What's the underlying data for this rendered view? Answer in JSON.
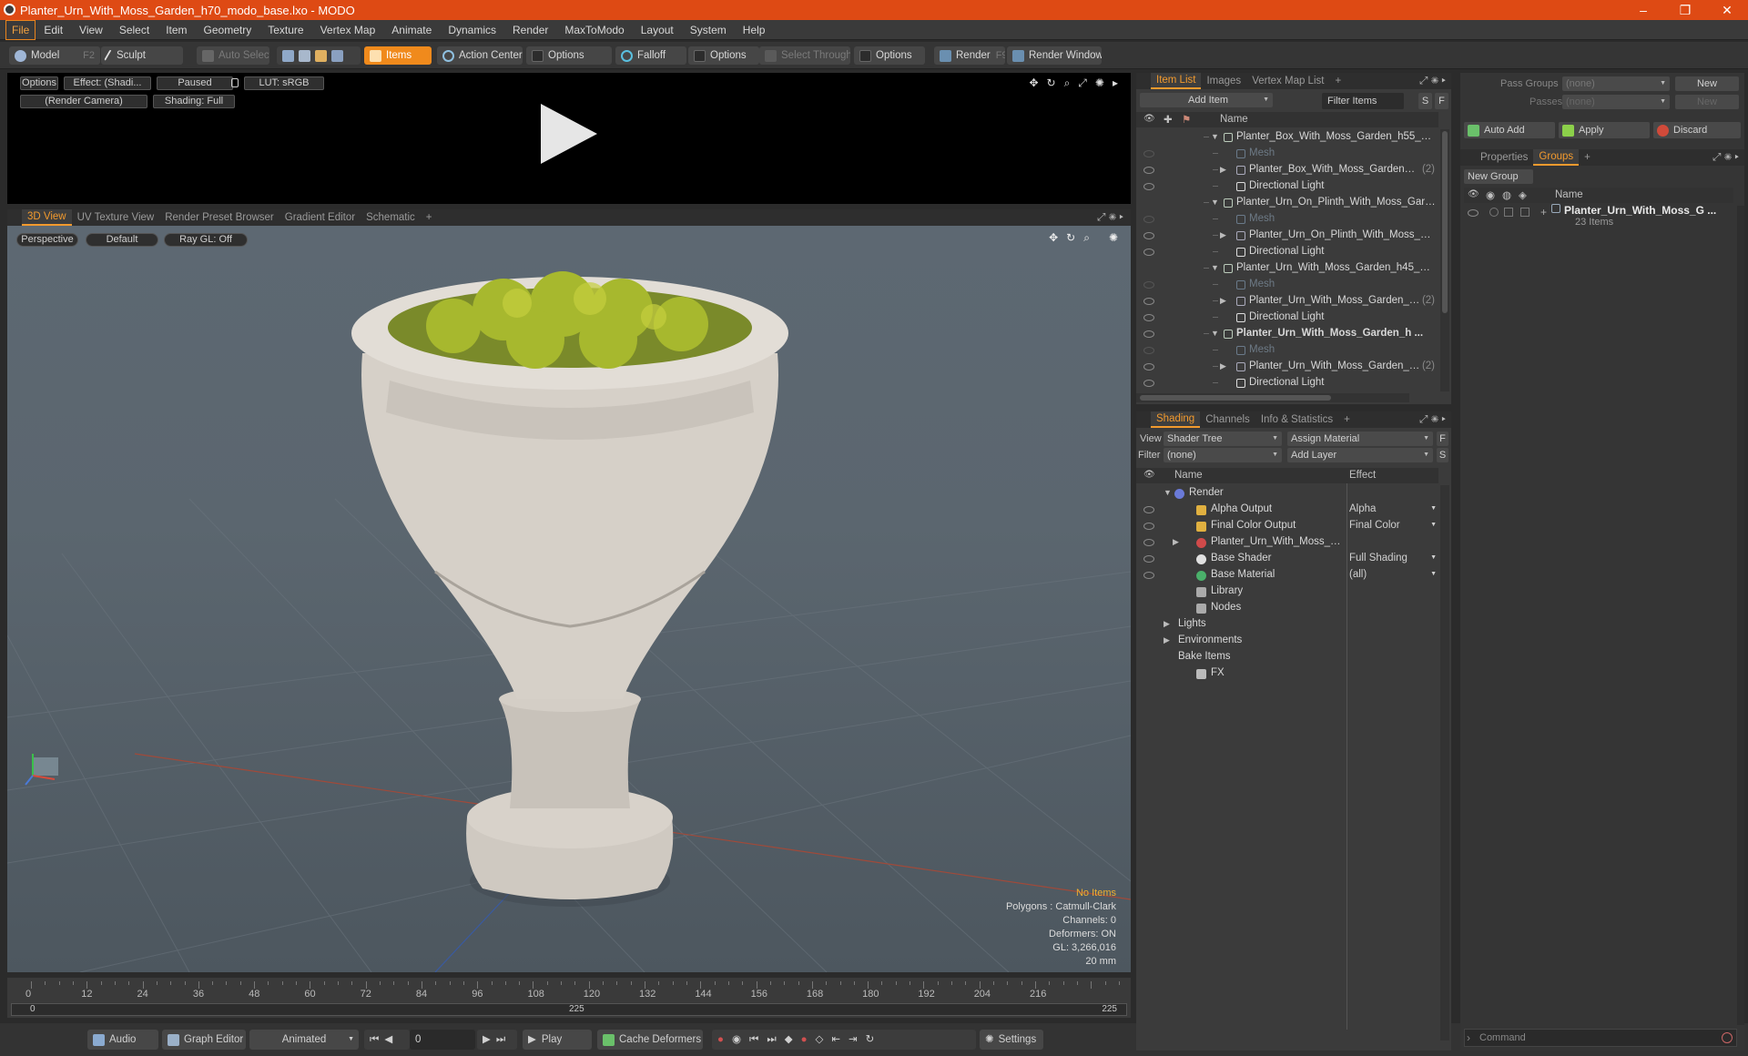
{
  "window": {
    "title": "Planter_Urn_With_Moss_Garden_h70_modo_base.lxo - MODO",
    "min": "–",
    "max": "❐",
    "close": "✕"
  },
  "menu": [
    "File",
    "Edit",
    "View",
    "Select",
    "Item",
    "Geometry",
    "Texture",
    "Vertex Map",
    "Animate",
    "Dynamics",
    "Render",
    "MaxToModo",
    "Layout",
    "System",
    "Help"
  ],
  "toolbar": {
    "model": "Model",
    "model_key": "F2",
    "sculpt": "Sculpt",
    "auto_select": "Auto Select",
    "items": "Items",
    "action_center": "Action Center",
    "options1": "Options",
    "falloff": "Falloff",
    "options2": "Options",
    "select_through": "Select Through",
    "options3": "Options",
    "render": "Render",
    "render_key": "F9",
    "render_window": "Render Window"
  },
  "render_preview": {
    "options": "Options",
    "effect": "Effect: (Shadi...",
    "paused": "Paused",
    "lut": "LUT: sRGB",
    "camera": "(Render Camera)",
    "shading": "Shading: Full"
  },
  "view_tabs": [
    "3D View",
    "UV Texture View",
    "Render Preset Browser",
    "Gradient Editor",
    "Schematic",
    "+"
  ],
  "viewport": {
    "perspective": "Perspective",
    "default": "Default",
    "raygl": "Ray GL: Off",
    "hud": {
      "no_items": "No Items",
      "polygons": "Polygons : Catmull-Clark",
      "channels": "Channels: 0",
      "deformers": "Deformers: ON",
      "gl": "GL: 3,266,016",
      "scale": "20 mm"
    }
  },
  "timeline": {
    "ticks": [
      "0",
      "12",
      "24",
      "36",
      "48",
      "60",
      "72",
      "84",
      "96",
      "108",
      "120",
      "132",
      "144",
      "156",
      "168",
      "180",
      "192",
      "204",
      "216"
    ],
    "range_start": "0",
    "range_mid": "225",
    "range_end": "225"
  },
  "bottom": {
    "audio": "Audio",
    "graph_editor": "Graph Editor",
    "animated": "Animated",
    "frame": "0",
    "play": "Play",
    "cache": "Cache Deformers",
    "settings": "Settings"
  },
  "item_list": {
    "tabs": [
      "Item List",
      "Images",
      "Vertex Map List",
      "+"
    ],
    "add_item": "Add Item",
    "filter": "Filter Items",
    "s": "S",
    "f": "F",
    "col_name": "Name",
    "rows": [
      {
        "indent": 1,
        "arrow": "▼",
        "label": "Planter_Box_With_Moss_Garden_h55_mo...",
        "eye": false,
        "kind": "scene",
        "bold": false
      },
      {
        "indent": 2,
        "arrow": "",
        "label": "Mesh",
        "eye": true,
        "kind": "mesh",
        "dim": true
      },
      {
        "indent": 2,
        "arrow": "▶",
        "label": "Planter_Box_With_Moss_Garden_h55",
        "count": "(2)",
        "eye": true,
        "kind": "item"
      },
      {
        "indent": 2,
        "arrow": "",
        "label": "Directional Light",
        "eye": true,
        "kind": "light"
      },
      {
        "indent": 1,
        "arrow": "▼",
        "label": "Planter_Urn_On_Plinth_With_Moss_Garde...",
        "eye": false,
        "kind": "scene"
      },
      {
        "indent": 2,
        "arrow": "",
        "label": "Mesh",
        "eye": true,
        "kind": "mesh",
        "dim": true
      },
      {
        "indent": 2,
        "arrow": "▶",
        "label": "Planter_Urn_On_Plinth_With_Moss_Gar...",
        "eye": true,
        "kind": "item"
      },
      {
        "indent": 2,
        "arrow": "",
        "label": "Directional Light",
        "eye": true,
        "kind": "light"
      },
      {
        "indent": 1,
        "arrow": "▼",
        "label": "Planter_Urn_With_Moss_Garden_h45_mo ...",
        "eye": false,
        "kind": "scene"
      },
      {
        "indent": 2,
        "arrow": "",
        "label": "Mesh",
        "eye": true,
        "kind": "mesh",
        "dim": true
      },
      {
        "indent": 2,
        "arrow": "▶",
        "label": "Planter_Urn_With_Moss_Garden_h45",
        "count": "(2)",
        "eye": true,
        "kind": "item"
      },
      {
        "indent": 2,
        "arrow": "",
        "label": "Directional Light",
        "eye": true,
        "kind": "light"
      },
      {
        "indent": 1,
        "arrow": "▼",
        "label": "Planter_Urn_With_Moss_Garden_h ...",
        "eye": true,
        "kind": "scene",
        "bold": true
      },
      {
        "indent": 2,
        "arrow": "",
        "label": "Mesh",
        "eye": true,
        "kind": "mesh",
        "dim": true
      },
      {
        "indent": 2,
        "arrow": "▶",
        "label": "Planter_Urn_With_Moss_Garden_h70",
        "count": "(2)",
        "eye": true,
        "kind": "item"
      },
      {
        "indent": 2,
        "arrow": "",
        "label": "Directional Light",
        "eye": true,
        "kind": "light"
      }
    ]
  },
  "shading": {
    "tabs": [
      "Shading",
      "Channels",
      "Info & Statistics",
      "+"
    ],
    "view_label": "View",
    "view_value": "Shader Tree",
    "assign": "Assign Material",
    "f": "F",
    "filter_label": "Filter",
    "filter_value": "(none)",
    "add_layer": "Add Layer",
    "s": "S",
    "col_name": "Name",
    "col_effect": "Effect",
    "rows": [
      {
        "indent": 0,
        "arrow": "▼",
        "label": "Render",
        "effect": "",
        "eye": false,
        "kind": "render"
      },
      {
        "indent": 1,
        "arrow": "",
        "label": "Alpha Output",
        "effect": "Alpha",
        "eye": true,
        "kind": "output"
      },
      {
        "indent": 1,
        "arrow": "",
        "label": "Final Color Output",
        "effect": "Final Color",
        "eye": true,
        "kind": "output"
      },
      {
        "indent": 1,
        "arrow": "▶",
        "label": "Planter_Urn_With_Moss_Ga...",
        "effect": "",
        "eye": true,
        "kind": "mat"
      },
      {
        "indent": 1,
        "arrow": "",
        "label": "Base Shader",
        "effect": "Full Shading",
        "eye": true,
        "kind": "shader"
      },
      {
        "indent": 1,
        "arrow": "",
        "label": "Base Material",
        "effect": "(all)",
        "eye": true,
        "kind": "bmat"
      },
      {
        "indent": 1,
        "arrow": "",
        "label": "Library",
        "effect": "",
        "eye": false,
        "kind": "folder"
      },
      {
        "indent": 1,
        "arrow": "",
        "label": "Nodes",
        "effect": "",
        "eye": false,
        "kind": "folder"
      },
      {
        "indent": 0,
        "arrow": "▶",
        "label": "Lights",
        "effect": "",
        "eye": false,
        "kind": "none"
      },
      {
        "indent": 0,
        "arrow": "▶",
        "label": "Environments",
        "effect": "",
        "eye": false,
        "kind": "none"
      },
      {
        "indent": 0,
        "arrow": "",
        "label": "Bake Items",
        "effect": "",
        "eye": false,
        "kind": "none"
      },
      {
        "indent": 1,
        "arrow": "",
        "label": "FX",
        "effect": "",
        "eye": false,
        "kind": "fx"
      }
    ]
  },
  "right": {
    "pass_groups": "Pass Groups",
    "pass_value": "(none)",
    "new": "New",
    "passes": "Passes",
    "passes_value": "(none)",
    "new2": "New",
    "auto_add": "Auto Add",
    "apply": "Apply",
    "discard": "Discard",
    "tabs": [
      "Properties",
      "Groups",
      "+"
    ],
    "new_group": "New Group",
    "col_name": "Name",
    "group_name": "Planter_Urn_With_Moss_G ...",
    "group_count": "23 Items",
    "command": "Command"
  },
  "colors": {
    "accent": "#f29a2e",
    "titlebar": "#de4a14"
  }
}
